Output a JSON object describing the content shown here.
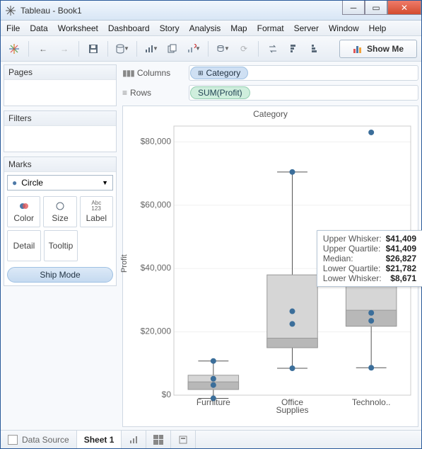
{
  "window_title": "Tableau - Book1",
  "menu": [
    "File",
    "Data",
    "Worksheet",
    "Dashboard",
    "Story",
    "Analysis",
    "Map",
    "Format",
    "Server",
    "Window",
    "Help"
  ],
  "showme_label": "Show Me",
  "panels": {
    "pages": "Pages",
    "filters": "Filters",
    "marks": "Marks"
  },
  "marks_type": "Circle",
  "mark_cards": {
    "color": "Color",
    "size": "Size",
    "label": "Label",
    "detail": "Detail",
    "tooltip": "Tooltip"
  },
  "ship_pill": "Ship Mode",
  "shelves": {
    "columns_label": "Columns",
    "rows_label": "Rows",
    "columns_pill": "Category",
    "rows_pill": "SUM(Profit)"
  },
  "viz_title": "Category",
  "ylabel": "Profit",
  "statusbar": {
    "data_source": "Data Source",
    "sheet": "Sheet 1"
  },
  "tooltip": {
    "labels": {
      "uw": "Upper Whisker:",
      "uq": "Upper Quartile:",
      "md": "Median:",
      "lq": "Lower Quartile:",
      "lw": "Lower Whisker:"
    },
    "values": {
      "uw": "$41,409",
      "uq": "$41,409",
      "md": "$26,827",
      "lq": "$21,782",
      "lw": "$8,671"
    }
  },
  "chart_data": {
    "type": "boxplot",
    "title": "Category",
    "xlabel": "",
    "ylabel": "Profit",
    "ylim": [
      0,
      85000
    ],
    "yticks": [
      0,
      20000,
      40000,
      60000,
      80000
    ],
    "ytick_labels": [
      "$0",
      "$20,000",
      "$40,000",
      "$60,000",
      "$80,000"
    ],
    "categories": [
      "Furniture",
      "Office Supplies",
      "Technolo.."
    ],
    "series": [
      {
        "name": "Furniture",
        "lower_whisker": -1000,
        "q1": 1800,
        "median": 4200,
        "q3": 6300,
        "upper_whisker": 10800,
        "points": [
          10800,
          5200,
          3200,
          -1000
        ]
      },
      {
        "name": "Office Supplies",
        "lower_whisker": 8500,
        "q1": 15000,
        "median": 18000,
        "q3": 38000,
        "upper_whisker": 70500,
        "points": [
          70500,
          26500,
          22500,
          8500
        ]
      },
      {
        "name": "Technology",
        "lower_whisker": 8671,
        "q1": 21782,
        "median": 26827,
        "q3": 41409,
        "upper_whisker": 41409,
        "points": [
          83000,
          26000,
          23500,
          8671
        ]
      }
    ]
  }
}
